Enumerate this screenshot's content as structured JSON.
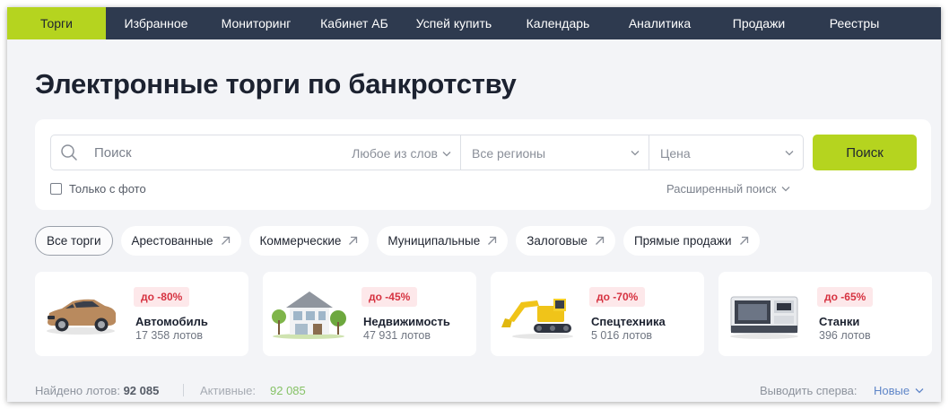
{
  "nav": {
    "items": [
      "Торги",
      "Избранное",
      "Мониторинг",
      "Кабинет АБ",
      "Успей купить",
      "Календарь",
      "Аналитика",
      "Продажи",
      "Реестры"
    ]
  },
  "page": {
    "title": "Электронные торги по банкротству"
  },
  "search": {
    "placeholder": "Поиск",
    "words_mode": "Любое из слов",
    "region": "Все регионы",
    "price": "Цена",
    "button": "Поиск",
    "photo_only": "Только с фото",
    "advanced": "Расширенный поиск"
  },
  "filters": {
    "chips": [
      "Все торги",
      "Арестованные",
      "Коммерческие",
      "Муниципальные",
      "Залоговые",
      "Прямые продажи"
    ]
  },
  "categories": [
    {
      "discount": "до -80%",
      "name": "Автомобиль",
      "count": "17 358 лотов",
      "icon": "car-icon"
    },
    {
      "discount": "до -45%",
      "name": "Недвижимость",
      "count": "47 931 лотов",
      "icon": "house-icon"
    },
    {
      "discount": "до -70%",
      "name": "Спецтехника",
      "count": "5 016 лотов",
      "icon": "excavator-icon"
    },
    {
      "discount": "до -65%",
      "name": "Станки",
      "count": "396 лотов",
      "icon": "machine-tool-icon"
    }
  ],
  "results": {
    "found_label": "Найдено лотов:",
    "found_value": "92 085",
    "active_label": "Активные:",
    "active_value": "92 085",
    "sort_label": "Выводить сперва:",
    "sort_value": "Новые"
  },
  "colors": {
    "nav_bg": "#2e3a4f",
    "accent": "#b5d41f",
    "discount_bg": "#fde8ea",
    "discount_text": "#d63240"
  }
}
